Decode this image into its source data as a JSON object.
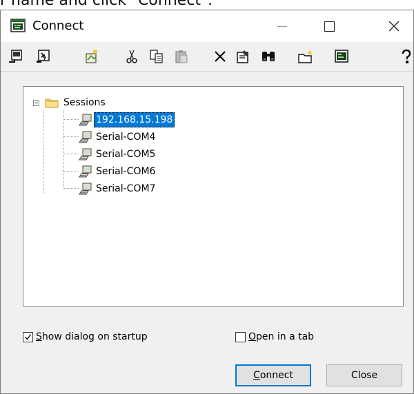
{
  "caption": {
    "text": "r name and click \"Connect\"."
  },
  "window": {
    "title": "Connect",
    "controls": {
      "minimize": "—",
      "maximize": "☐",
      "close": "✕"
    }
  },
  "toolbar": {
    "buttons": [
      {
        "name": "connect-icon"
      },
      {
        "name": "quick-connect-icon"
      },
      {
        "name": "new-session-icon"
      },
      {
        "name": "cut-icon"
      },
      {
        "name": "copy-icon"
      },
      {
        "name": "paste-icon"
      },
      {
        "name": "delete-icon"
      },
      {
        "name": "properties-icon"
      },
      {
        "name": "find-icon"
      },
      {
        "name": "new-folder-icon"
      },
      {
        "name": "desktop-shortcut-icon"
      },
      {
        "name": "help-icon"
      }
    ]
  },
  "tree": {
    "root": {
      "label": "Sessions",
      "expander": "⊟"
    },
    "items": [
      {
        "label": "192.168.15.198",
        "selected": true
      },
      {
        "label": "Serial-COM4",
        "selected": false
      },
      {
        "label": "Serial-COM5",
        "selected": false
      },
      {
        "label": "Serial-COM6",
        "selected": false
      },
      {
        "label": "Serial-COM7",
        "selected": false
      }
    ]
  },
  "options": {
    "show_dialog": {
      "prefix": "S",
      "rest": "how dialog on startup",
      "checked": true
    },
    "open_in_tab": {
      "prefix": "O",
      "rest": "pen in a tab",
      "checked": false
    }
  },
  "buttons": {
    "connect": {
      "prefix": "C",
      "rest": "onnect"
    },
    "close": "Close"
  },
  "colors": {
    "selection": "#0078d7",
    "folder": "#f5d76e",
    "window_bg": "#f0f0f0"
  }
}
